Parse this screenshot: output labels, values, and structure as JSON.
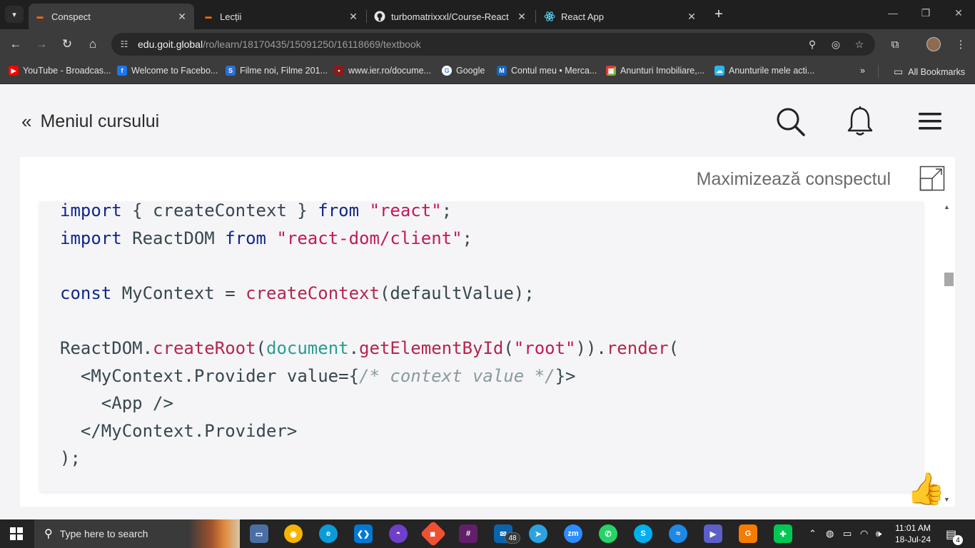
{
  "browser": {
    "tabs": [
      {
        "title": "Conspect",
        "favicon": "goit-icon",
        "active": true
      },
      {
        "title": "Lecții",
        "favicon": "goit-icon",
        "active": false
      },
      {
        "title": "turbomatrixxxl/Course-React",
        "favicon": "github-icon",
        "active": false
      },
      {
        "title": "React App",
        "favicon": "react-icon",
        "active": false
      }
    ],
    "url_host": "edu.goit.global",
    "url_path": "/ro/learn/18170435/15091250/16118669/textbook",
    "bookmarks": [
      {
        "label": "YouTube - Broadcas...",
        "color": "#ff0000",
        "icon": "youtube-icon"
      },
      {
        "label": "Welcome to Facebo...",
        "color": "#1877f2",
        "icon": "facebook-icon"
      },
      {
        "label": "Filme noi, Filme 201...",
        "color": "#2a6fd6",
        "icon": "film-icon"
      },
      {
        "label": "www.ier.ro/docume...",
        "color": "#8b1a1a",
        "icon": "ier-icon"
      },
      {
        "label": "Google",
        "color": "#ffffff",
        "icon": "google-icon"
      },
      {
        "label": "Contul meu • Merca...",
        "color": "#1565c0",
        "icon": "mercado-icon"
      },
      {
        "label": "Anunturi Imobiliare,...",
        "color": "#7cb342",
        "icon": "imobiliare-icon"
      },
      {
        "label": "Anunturile mele acti...",
        "color": "#29b6f6",
        "icon": "anunturi-icon"
      }
    ],
    "all_bookmarks": "All Bookmarks"
  },
  "page": {
    "back_label": "Meniul cursului",
    "maximize_label": "Maximizează conspectul"
  },
  "taskbar": {
    "search_placeholder": "Type here to search",
    "mail_badge": "48",
    "time": "11:01 AM",
    "date": "18-Jul-24",
    "notifications": "4"
  }
}
